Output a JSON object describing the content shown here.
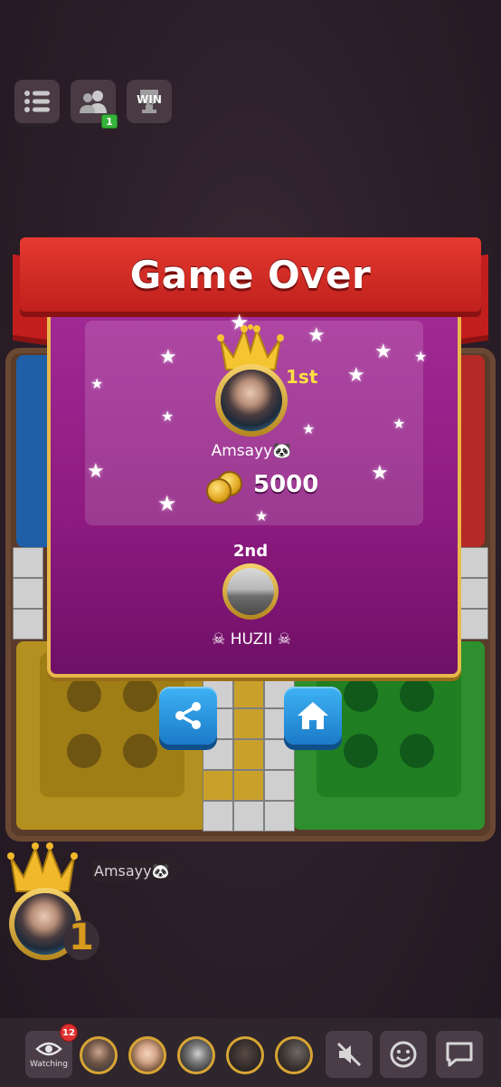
{
  "top_bar": {
    "menu_icon": "list-icon",
    "friends_icon": "friends-icon",
    "friends_badge": "1",
    "win_label": "WIN"
  },
  "modal": {
    "title": "Game Over",
    "first": {
      "rank": "1st",
      "name": "Amsayy🐼",
      "coins": "5000"
    },
    "second": {
      "rank": "2nd",
      "name": "☠ HUZII ☠"
    },
    "buttons": {
      "share_icon": "share-icon",
      "home_icon": "home-icon"
    }
  },
  "player": {
    "name": "Amsayy🐼",
    "rank_number": "1"
  },
  "bottom_bar": {
    "watching_label": "Watching",
    "watching_count": "12",
    "icons": [
      "mute-icon",
      "emoji-icon",
      "chat-icon"
    ]
  },
  "colors": {
    "banner_red": "#d12a25",
    "modal_purple": "#8c1a7f",
    "gold": "#e9b84a",
    "button_blue": "#2f9ae3"
  }
}
